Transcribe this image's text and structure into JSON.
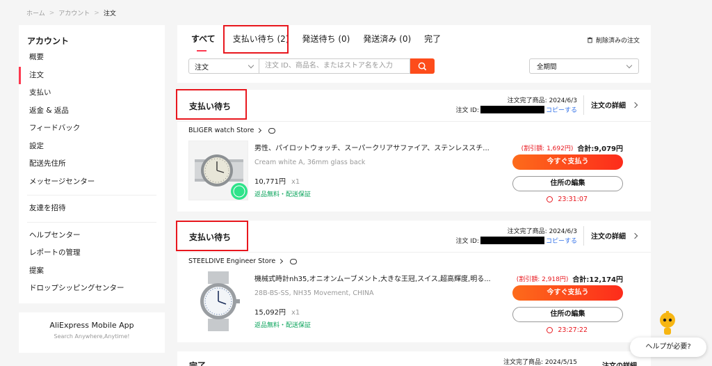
{
  "breadcrumb": [
    "ホーム",
    "アカウント",
    "注文"
  ],
  "sidebar": {
    "title": "アカウント",
    "items": [
      "概要",
      "注文",
      "支払い",
      "返金 & 返品",
      "フィードバック",
      "設定",
      "配送先住所",
      "メッセージセンター"
    ],
    "items2": [
      "友達を招待"
    ],
    "items3": [
      "ヘルプセンター",
      "レポートの管理",
      "提案",
      "ドロップシッピングセンター"
    ],
    "active": "注文"
  },
  "mobile": {
    "title": "AliExpress Mobile App",
    "subtitle": "Search Anywhere,Anytime!"
  },
  "tabs": [
    "すべて",
    "支払い待ち (2)",
    "発送待ち (0)",
    "発送済み (0)",
    "完了"
  ],
  "deleted_label": "削除済みの注文",
  "search": {
    "type_value": "注文",
    "placeholder": "注文 ID、商品名、またはストア名を入力"
  },
  "period_value": "全期間",
  "orders": [
    {
      "status": "支払い待ち",
      "date": "注文完了商品: 2024/6/3",
      "id_label": "注文 ID:",
      "copy": "コピーする",
      "detail": "注文の詳細",
      "store": "BLIGER watch Store",
      "product": "男性、パイロットウォッチ、スーパークリアサファイア、ステンレススチ...",
      "variant": "Cream white A, 36mm glass back",
      "price": "10,771円",
      "qty": "x1",
      "free": "返品無料・配送保証",
      "discount": "(割引額: 1,692円)",
      "total": "合計:9,079円",
      "pay": "今すぐ支払う",
      "edit": "住所の編集",
      "timer": "23:31:07"
    },
    {
      "status": "支払い待ち",
      "date": "注文完了商品: 2024/6/3",
      "id_label": "注文 ID:",
      "copy": "コピーする",
      "detail": "注文の詳細",
      "store": "STEELDIVE Engineer Store",
      "product": "機械式時計nh35,オニオンムーブメント,大きな王冠,スイス,超高輝度,明る...",
      "variant": "28B-BS-SS, NH35 Movement, CHINA",
      "price": "15,092円",
      "qty": "x1",
      "free": "返品無料・配送保証",
      "discount": "(割引額: 2,918円)",
      "total": "合計:12,174円",
      "pay": "今すぐ支払う",
      "edit": "住所の編集",
      "timer": "23:27:22"
    }
  ],
  "order3": {
    "status": "完了",
    "date": "注文完了商品: 2024/5/15",
    "detail": "注文の詳細"
  },
  "help": "ヘルプが必要?"
}
